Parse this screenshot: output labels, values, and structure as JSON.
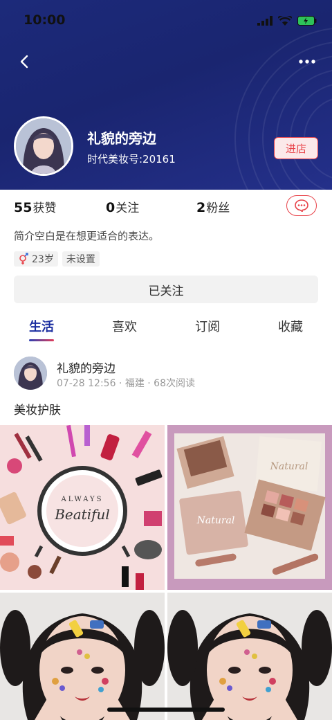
{
  "status_bar": {
    "time": "10:00"
  },
  "profile": {
    "name": "礼貌的旁边",
    "id_text": "时代美妆号:20161",
    "shop_label": "进店"
  },
  "stats": {
    "likes_count": "55",
    "likes_label": "获赞",
    "following_count": "0",
    "following_label": "关注",
    "fans_count": "2",
    "fans_label": "粉丝"
  },
  "bio": "简介空白是在想更适合的表达。",
  "tags": {
    "age": "23岁",
    "location": "未设置"
  },
  "follow_label": "已关注",
  "tabs": [
    {
      "label": "生活"
    },
    {
      "label": "喜欢"
    },
    {
      "label": "订阅"
    },
    {
      "label": "收藏"
    }
  ],
  "post": {
    "author": "礼貌的旁边",
    "meta": "07-28 12:56 · 福建 · 68次阅读",
    "title": "美妆护肤",
    "image1_text_top": "ALWAYS",
    "image1_text_main": "Beatiful",
    "image2_text_a": "Natural",
    "image2_text_b": "Natural"
  },
  "colors": {
    "header": "#1c2a7a",
    "accent": "#e8434a",
    "tab_active": "#1b2ea0"
  }
}
